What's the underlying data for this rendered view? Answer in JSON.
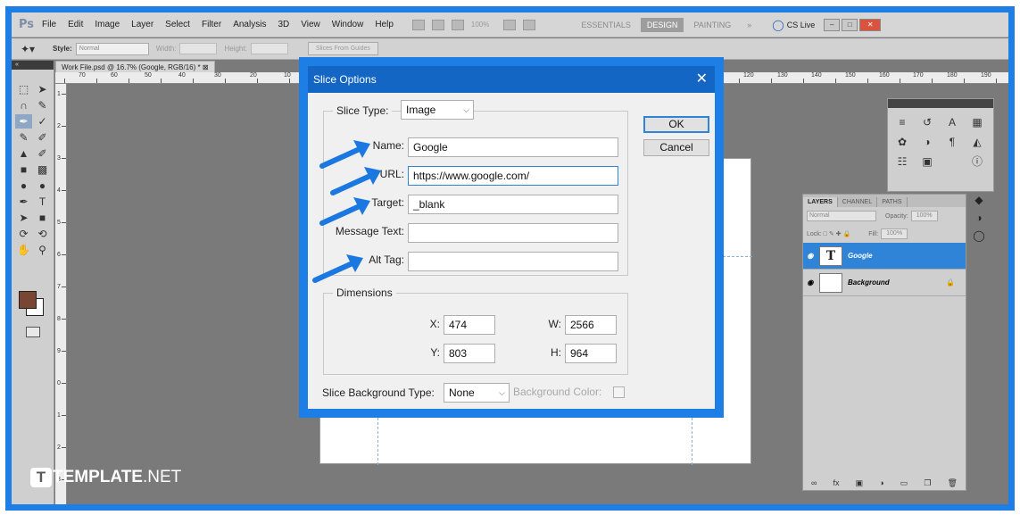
{
  "menubar": {
    "logo": "Ps",
    "items": [
      "File",
      "Edit",
      "Image",
      "Layer",
      "Select",
      "Filter",
      "Analysis",
      "3D",
      "View",
      "Window",
      "Help"
    ],
    "zoom": "100%",
    "workspaces": [
      "ESSENTIALS",
      "DESIGN",
      "PAINTING",
      "»"
    ],
    "cslive": "CS Live"
  },
  "optbar": {
    "style_label": "Style:",
    "style_value": "Normal",
    "width_label": "Width:",
    "height_label": "Height:",
    "slices_button": "Slices From Guides"
  },
  "document": {
    "tab_title": "Work File.psd @ 16.7% (Google, RGB/16) *",
    "ruler_top": [
      "70",
      "60",
      "50",
      "40",
      "30",
      "20",
      "10",
      "120",
      "130",
      "140",
      "150",
      "160",
      "170",
      "180",
      "190"
    ],
    "ruler_left": [
      "1",
      "2",
      "3",
      "4",
      "5",
      "6",
      "7",
      "8",
      "9",
      "0",
      "1",
      "2",
      "3"
    ]
  },
  "dialog": {
    "title": "Slice Options",
    "slice_type_label": "Slice Type:",
    "slice_type_value": "Image",
    "name_label": "Name:",
    "name_value": "Google",
    "url_label": "URL:",
    "url_value": "https://www.google.com/",
    "target_label": "Target:",
    "target_value": "_blank",
    "message_label": "Message Text:",
    "message_value": "",
    "alt_label": "Alt Tag:",
    "alt_value": "",
    "dimensions_legend": "Dimensions",
    "x_label": "X:",
    "x_value": "474",
    "y_label": "Y:",
    "y_value": "803",
    "w_label": "W:",
    "w_value": "2566",
    "h_label": "H:",
    "h_value": "964",
    "bg_type_label": "Slice Background Type:",
    "bg_type_value": "None",
    "bg_color_label": "Background Color:",
    "ok_label": "OK",
    "cancel_label": "Cancel"
  },
  "layers": {
    "tabs": [
      "LAYERS",
      "CHANNEL",
      "PATHS"
    ],
    "blend_mode": "Normal",
    "opacity_label": "Opacity:",
    "opacity_value": "100%",
    "lock_label": "Lock:",
    "fill_label": "Fill:",
    "fill_value": "100%",
    "items": [
      {
        "name": "Google",
        "thumb": "T"
      },
      {
        "name": "Background",
        "thumb": ""
      }
    ]
  },
  "watermark": {
    "logo_letter": "T",
    "brand": "TEMPLATE",
    "suffix": ".NET"
  },
  "colors": {
    "frame_blue": "#1d7ee6",
    "title_blue": "#1466c4",
    "arrow_blue": "#1a78e0",
    "foreground_swatch": "#7a4634",
    "selected_layer": "#2f84d8"
  }
}
